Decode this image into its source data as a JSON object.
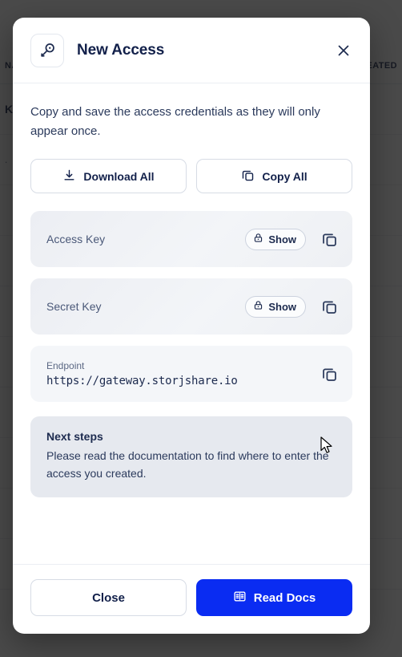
{
  "background": {
    "columns": [
      "NAME",
      "DATE CREATED"
    ],
    "rows": [
      {
        "label": "Key"
      },
      {
        "label": "."
      }
    ]
  },
  "modal": {
    "title": "New Access",
    "header_icon": "key-icon",
    "close_icon": "close-icon",
    "description": "Copy and save the access credentials as they will only appear once.",
    "actions": [
      {
        "label": "Download All",
        "icon": "download-icon"
      },
      {
        "label": "Copy All",
        "icon": "copy-icon"
      }
    ],
    "credentials": [
      {
        "label": "Access Key",
        "show_label": "Show",
        "show_icon": "lock-icon",
        "copy_icon": "copy-icon"
      },
      {
        "label": "Secret Key",
        "show_label": "Show",
        "show_icon": "lock-icon",
        "copy_icon": "copy-icon"
      }
    ],
    "endpoint": {
      "label": "Endpoint",
      "value": "https://gateway.storjshare.io",
      "copy_icon": "copy-icon"
    },
    "next_steps": {
      "title": "Next steps",
      "text": "Please read the documentation to find where to enter the access you created."
    },
    "footer": {
      "close_label": "Close",
      "docs_label": "Read Docs",
      "docs_icon": "book-icon"
    }
  },
  "colors": {
    "primary": "#0a2cf2",
    "text_dark": "#12204a",
    "overlay": "#171717"
  }
}
